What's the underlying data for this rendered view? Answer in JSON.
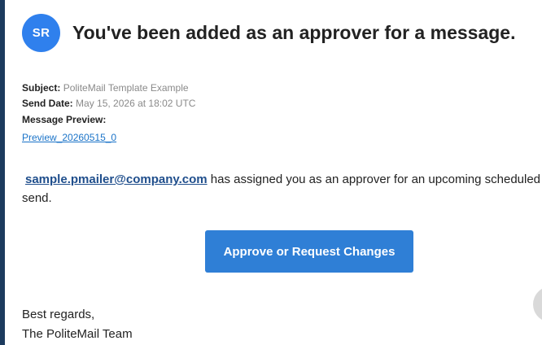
{
  "avatar": {
    "initials": "SR"
  },
  "headline": "You've been added as an approver for a message.",
  "meta": {
    "subject_label": "Subject:",
    "subject_value": "PoliteMail Template Example",
    "send_date_label": "Send Date:",
    "send_date_value": "May 15, 2026 at 18:02 UTC",
    "preview_label": "Message Preview:",
    "preview_link": "Preview_20260515_0"
  },
  "body": {
    "sender_email": "sample.pmailer@company.com",
    "message": " has assigned you as an approver for an upcoming scheduled send."
  },
  "cta": {
    "label": "Approve or Request Changes"
  },
  "signature": {
    "line1": "Best regards,",
    "line2": "The PoliteMail Team"
  },
  "colors": {
    "accent": "#2f7fd6",
    "avatar_bg": "#2f80ed",
    "left_bar": "#1c3b5e",
    "link": "#1a73c8"
  }
}
